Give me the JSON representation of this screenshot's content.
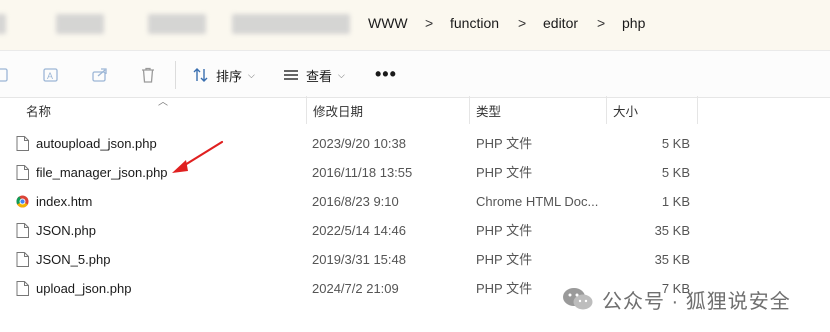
{
  "breadcrumbs": [
    "WWW",
    "function",
    "editor",
    "php"
  ],
  "breadcrumb_separator": ">",
  "toolbar": {
    "sort_label": "排序",
    "view_label": "查看",
    "more_label": "•••"
  },
  "columns": {
    "name": "名称",
    "date": "修改日期",
    "type": "类型",
    "size": "大小"
  },
  "files": [
    {
      "name": "autoupload_json.php",
      "date": "2023/9/20 10:38",
      "type": "PHP 文件",
      "size": "5 KB",
      "icon": "php-file-icon"
    },
    {
      "name": "file_manager_json.php",
      "date": "2016/11/18 13:55",
      "type": "PHP 文件",
      "size": "5 KB",
      "icon": "php-file-icon"
    },
    {
      "name": "index.htm",
      "date": "2016/8/23 9:10",
      "type": "Chrome HTML Doc...",
      "size": "1 KB",
      "icon": "chrome-html-icon"
    },
    {
      "name": "JSON.php",
      "date": "2022/5/14 14:46",
      "type": "PHP 文件",
      "size": "35 KB",
      "icon": "php-file-icon"
    },
    {
      "name": "JSON_5.php",
      "date": "2019/3/31 15:48",
      "type": "PHP 文件",
      "size": "35 KB",
      "icon": "php-file-icon"
    },
    {
      "name": "upload_json.php",
      "date": "2024/7/2 21:09",
      "type": "PHP 文件",
      "size": "7 KB",
      "icon": "php-file-icon"
    }
  ],
  "watermark": {
    "text": "公众号 · 狐狸说安全"
  },
  "colors": {
    "address_bar_bg": "#fbf8ef",
    "annotation_arrow": "#e02020",
    "toolbar_icon": "#3a6fb0"
  }
}
